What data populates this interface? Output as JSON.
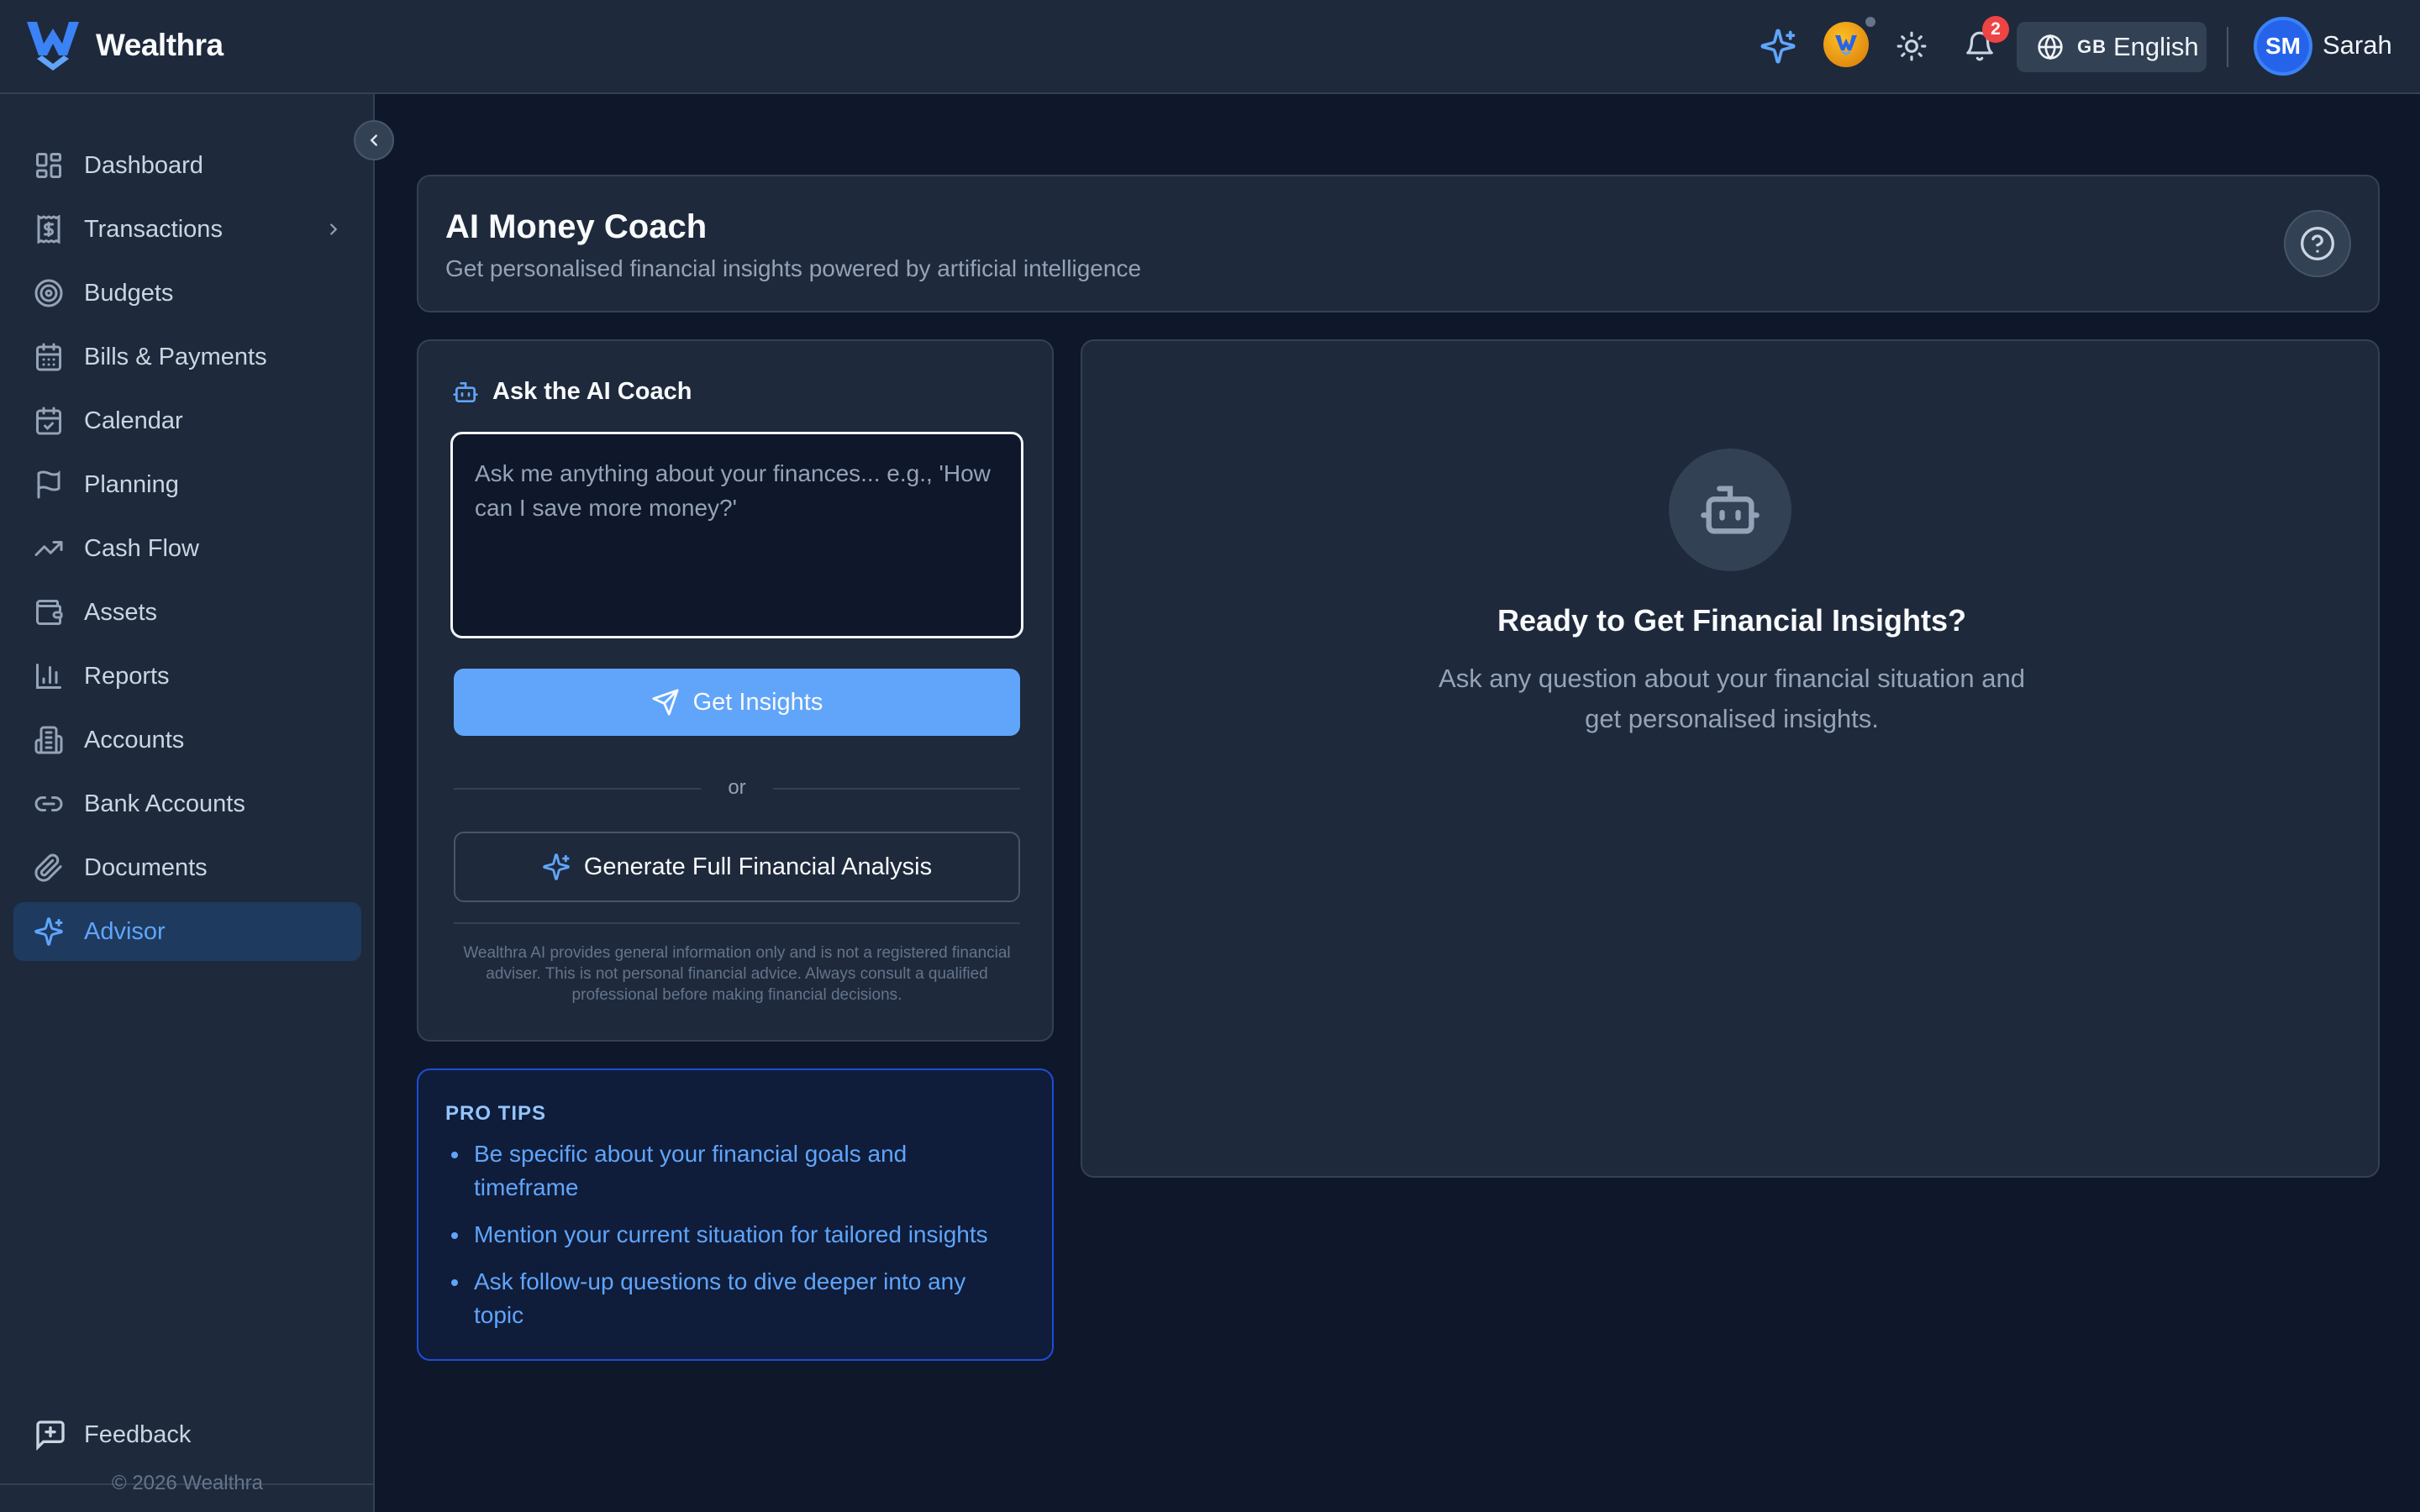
{
  "app": {
    "brand": "Wealthra"
  },
  "topbar": {
    "notification_count": "2",
    "language_flag": "GB",
    "language_label": "English",
    "user_initials": "SM",
    "user_name": "Sarah"
  },
  "sidebar": {
    "items": [
      {
        "label": "Dashboard",
        "icon": "dashboard-icon"
      },
      {
        "label": "Transactions",
        "icon": "receipt-dollar-icon",
        "has_submenu": true
      },
      {
        "label": "Budgets",
        "icon": "target-icon"
      },
      {
        "label": "Bills & Payments",
        "icon": "calendar-grid-icon"
      },
      {
        "label": "Calendar",
        "icon": "calendar-check-icon"
      },
      {
        "label": "Planning",
        "icon": "flag-icon"
      },
      {
        "label": "Cash Flow",
        "icon": "trending-up-icon"
      },
      {
        "label": "Assets",
        "icon": "wallet-icon"
      },
      {
        "label": "Reports",
        "icon": "bar-chart-icon"
      },
      {
        "label": "Accounts",
        "icon": "building-icon"
      },
      {
        "label": "Bank Accounts",
        "icon": "link-icon"
      },
      {
        "label": "Documents",
        "icon": "paperclip-icon"
      },
      {
        "label": "Advisor",
        "icon": "sparkles-icon",
        "active": true
      }
    ],
    "feedback_label": "Feedback",
    "copyright": "© 2026 Wealthra"
  },
  "header": {
    "title": "AI Money Coach",
    "subtitle": "Get personalised financial insights powered by artificial intelligence"
  },
  "ask": {
    "title": "Ask the AI Coach",
    "placeholder": "Ask me anything about your finances... e.g., 'How can I save more money?'",
    "value": "",
    "insights_button": "Get Insights",
    "or_label": "or",
    "analysis_button": "Generate Full Financial Analysis",
    "disclaimer": "Wealthra AI provides general information only and is not a registered financial adviser. This is not personal financial advice. Always consult a qualified professional before making financial decisions."
  },
  "tips": {
    "title": "PRO TIPS",
    "items": [
      "Be specific about your financial goals and timeframe",
      "Mention your current situation for tailored insights",
      "Ask follow-up questions to dive deeper into any topic"
    ]
  },
  "result": {
    "title": "Ready to Get Financial Insights?",
    "subtitle_line1": "Ask any question about your financial situation and",
    "subtitle_line2": "get personalised insights."
  },
  "colors": {
    "background": "#0f172a",
    "surface": "#1e293b",
    "border": "#334155",
    "accent": "#60a5fa",
    "active_nav_bg": "#1e3a5f",
    "badge": "#ef4444"
  }
}
